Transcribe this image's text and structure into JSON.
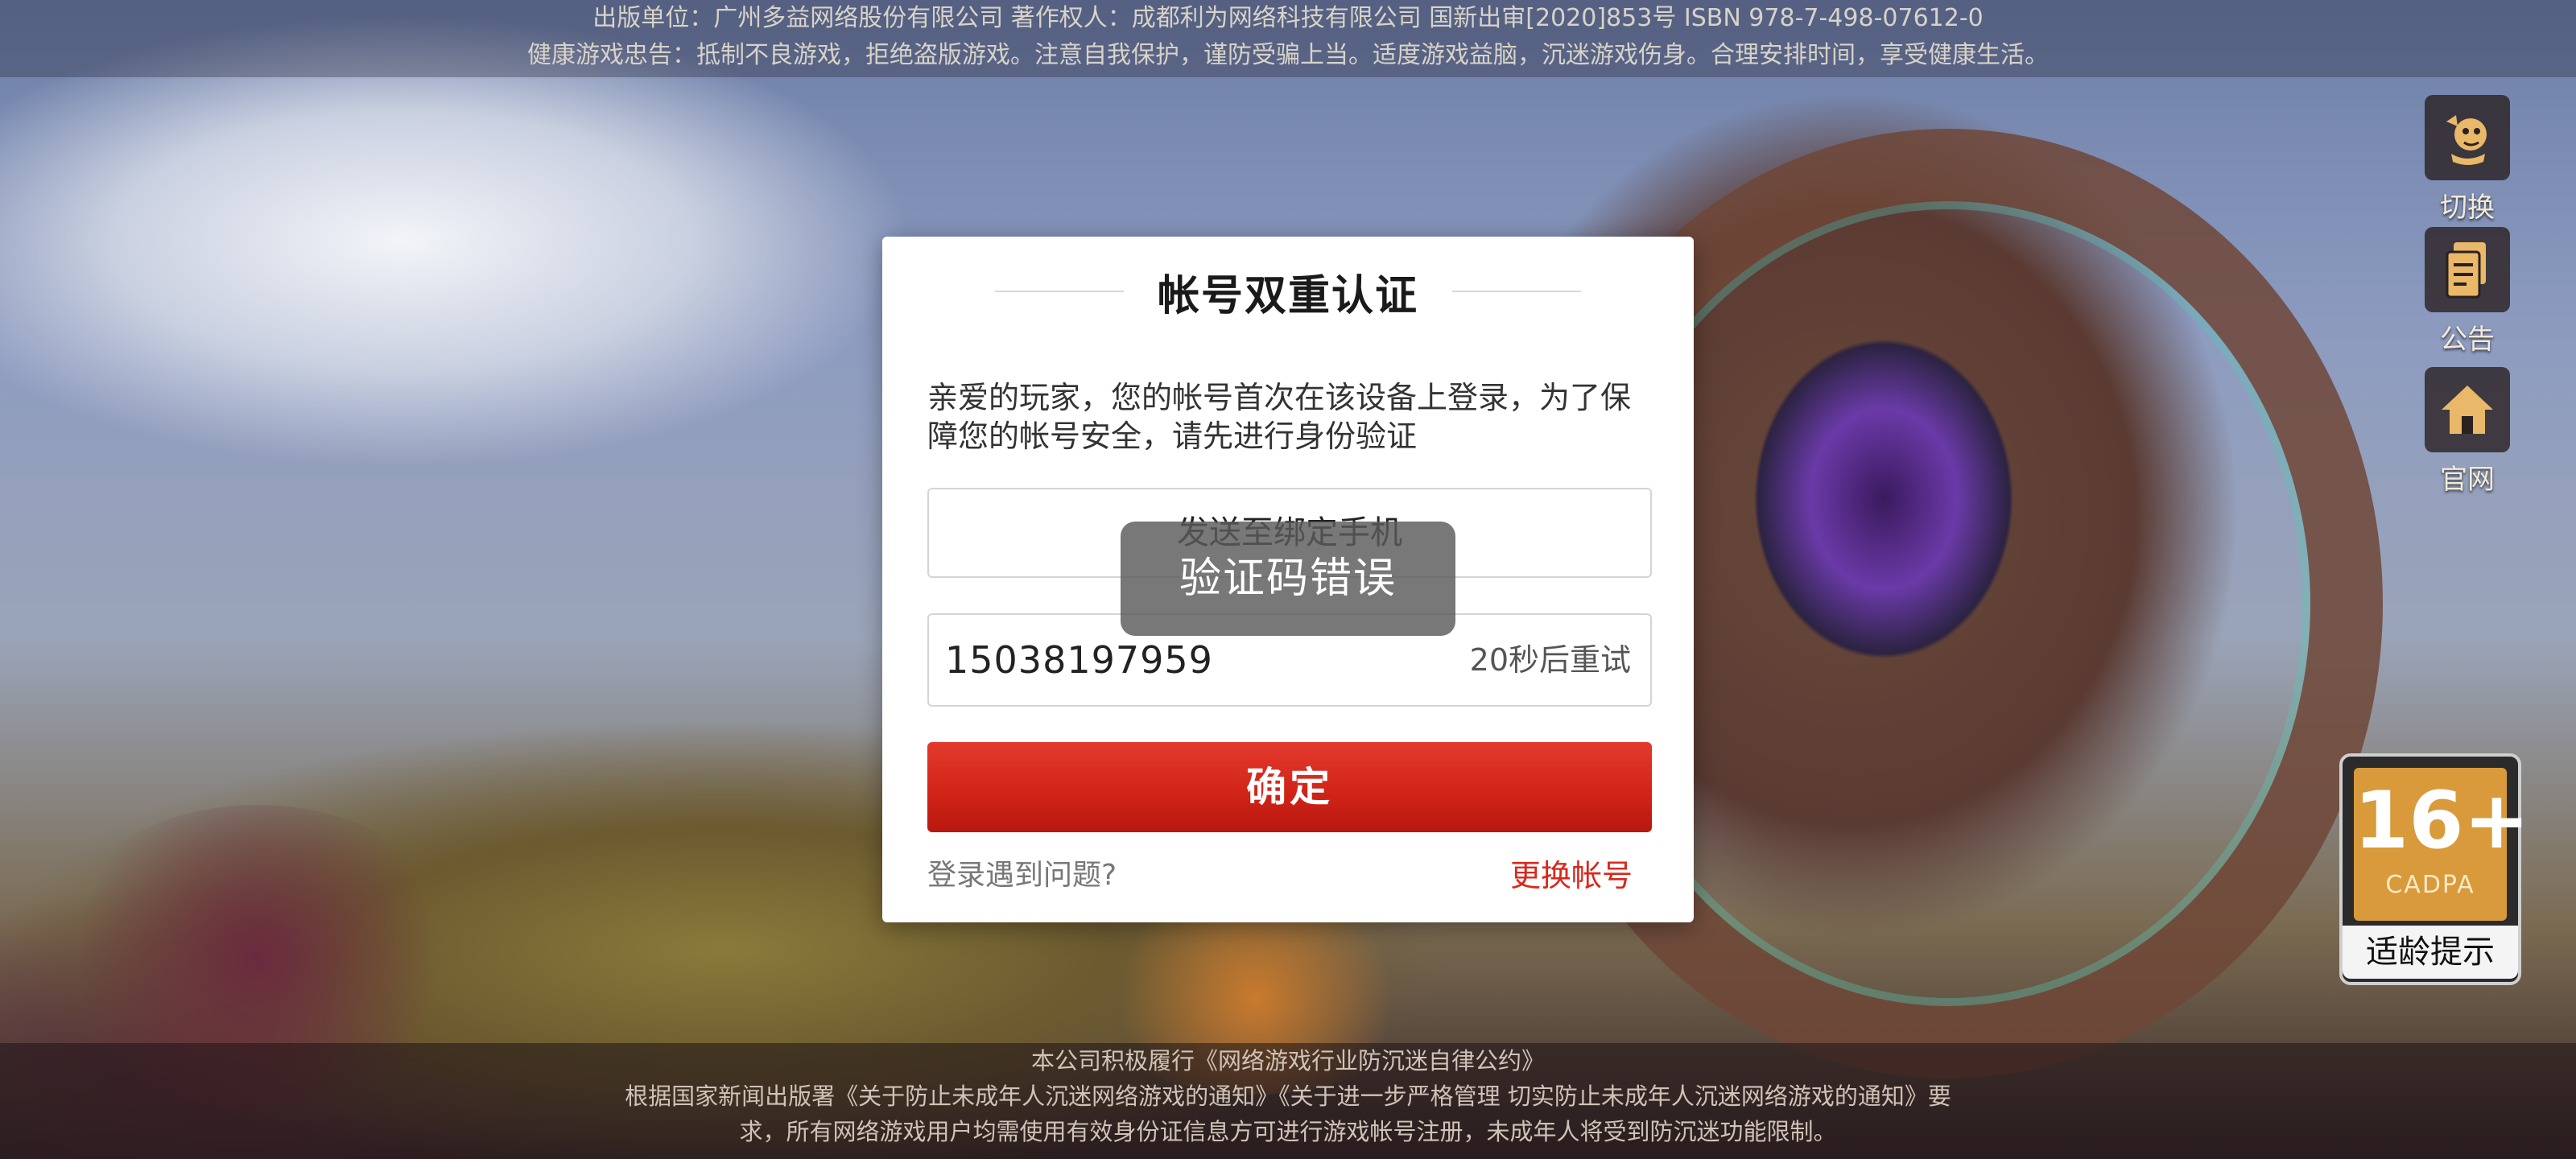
{
  "header": {
    "publisher_line": "出版单位：广州多益网络股份有限公司 著作权人：成都利为网络科技有限公司 国新出审[2020]853号 ISBN 978-7-498-07612-0",
    "health_notice": "健康游戏忠告：抵制不良游戏，拒绝盗版游戏。注意自我保护，谨防受骗上当。适度游戏益脑，沉迷游戏伤身。合理安排时间，享受健康生活。"
  },
  "sidebar": {
    "items": [
      {
        "label": "切换",
        "icon": "switch-character-icon"
      },
      {
        "label": "公告",
        "icon": "notice-document-icon"
      },
      {
        "label": "官网",
        "icon": "home-icon"
      }
    ]
  },
  "age_rating": {
    "number": "16+",
    "org": "CADPA",
    "label": "适龄提示",
    "color": "#d89a3a"
  },
  "dialog": {
    "title": "帐号双重认证",
    "description": "亲爱的玩家，您的帐号首次在该设备上登录，为了保障您的帐号安全，请先进行身份验证",
    "send_button_label": "发送至绑定手机",
    "phone_value": "15038197959",
    "retry_label": "20秒后重试",
    "confirm_label": "确定",
    "help_link": "登录遇到问题?",
    "switch_account_label": "更换帐号",
    "accent_color": "#d8281c"
  },
  "toast": {
    "message": "验证码错误"
  },
  "footer": {
    "line1": "本公司积极履行《网络游戏行业防沉迷自律公约》",
    "line2": "根据国家新闻出版署《关于防止未成年人沉迷网络游戏的通知》《关于进一步严格管理 切实防止未成年人沉迷网络游戏的通知》要",
    "line3": "求，所有网络游戏用户均需使用有效身份证信息方可进行游戏帐号注册，未成年人将受到防沉迷功能限制。"
  }
}
